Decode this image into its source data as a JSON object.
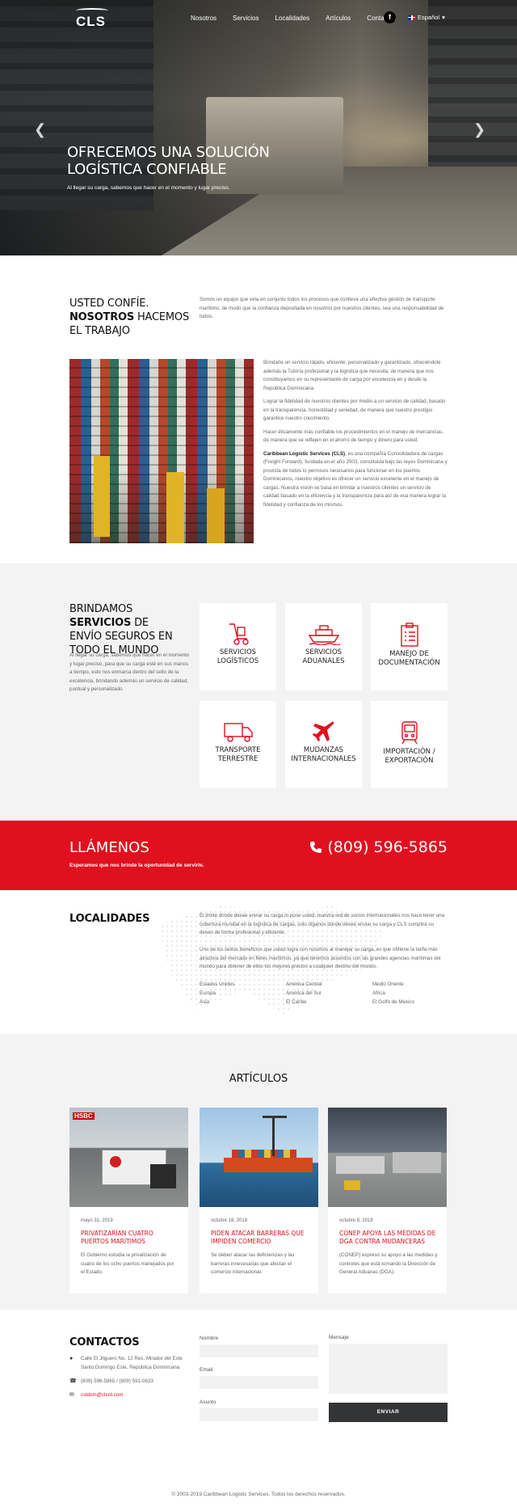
{
  "nav": {
    "logo": "CLS",
    "items": [
      "Nosotros",
      "Servicios",
      "Localidades",
      "Artículos",
      "Contactos"
    ],
    "facebook": "f",
    "language": "Español"
  },
  "hero": {
    "title": "OFRECEMOS UNA SOLUCIÓN LOGÍSTICA CONFIABLE",
    "subtitle": "Al llegar su carga, sabemos que hacer en el momento y lugar preciso.",
    "prev_icon": "chevron-left-icon",
    "next_icon": "chevron-right-icon"
  },
  "intro": {
    "heading_1": "USTED CONFÍE.",
    "heading_2_bold": "NOSOTROS",
    "heading_2_rest": " HACEMOS EL TRABAJO",
    "lead": "Somos un equipo que vela en conjunto todos los procesos que conlleva una efectiva gestión de transporte marítimo, de modo que la confianza depositada en nosotros por nuestros clientes, sea una responsabilidad de todos.",
    "p1": "Brindarle un servicio rápido, eficiente, personalizado y garantizado, ofreciéndole además la Tutoría profesional y la logística que necesita, de manera que nos constituyamos en su representante de carga por excelencia en y desde la República Dominicana.",
    "p2": "Lograr la fidelidad de nuestros clientes por medio a un servicio de calidad, basado en la transparencia, honestidad y seriedad, de manera que nuestro prestigio garantice nuestro crecimiento.",
    "p3": "Hacer éticamente más confiable los procedimientos en el manejo de mercancías, de manera que se reflejen en el ahorro de tiempo y dinero para usted.",
    "p4_bold": "Caribbean Logistic Services (CLS)",
    "p4_rest": ", es una compañía Consolidadora de cargas (Freight Forward), fundada en el año 2003, constituida bajo las leyes Dominicana y provista de todos lo permisos necesarios para funcionar en los puertos Dominicanos, nuestro objetivo es ofrecer un servicio excelente en el manejo de cargas. Nuestra visión se basa en brindar a nuestros clientes un servicio de calidad basado en la eficiencia y la transparencia para así de esa manera lograr la fidelidad y confianza de los mismos."
  },
  "services": {
    "h_a": "BRINDAMOS ",
    "h_b": "SERVICIOS",
    "h_c": " DE ENVÍO SEGUROS EN TODO EL MUNDO",
    "text": "Al llegar su carga, sabemos que hacer en el momento y lugar preciso, para que su carga esté en sus manos a tiempo, esto nos enmarca dentro del sello de la excelencia, brindando además un servicio de calidad, puntual y personalizado.",
    "cards": [
      {
        "label": "SERVICIOS LOGÍSTICOS",
        "icon": "hand-truck-icon"
      },
      {
        "label": "SERVICIOS ADUANALES",
        "icon": "ship-icon"
      },
      {
        "label": "MANEJO DE DOCUMENTACIÓN",
        "icon": "clipboard-icon"
      },
      {
        "label": "TRANSPORTE TERRESTRE",
        "icon": "truck-icon"
      },
      {
        "label": "MUDANZAS INTERNACIONALES",
        "icon": "airplane-icon"
      },
      {
        "label": "IMPORTACIÓN / EXPORTACIÓN",
        "icon": "train-icon"
      }
    ]
  },
  "call": {
    "title": "LLÁMENOS",
    "subtitle": "Esperamos que nos brinde la oportunidad de servirle.",
    "phone": "(809) 596-5865",
    "accent": "#e0101f"
  },
  "locations": {
    "title": "LOCALIDADES",
    "p1": "El límite donde desee enviar su carga lo pone usted, nuestra red de socios internacionales nos hace tener una cobertura mundial en la logística de cargas, solo díganos donde desee enviar su carga y CLS cumplirá su deseo de forma profesional y eficiente.",
    "p2": "Uno de los tantos beneficios que usted logra con nosotros al manejar su carga, es que obtiene la tarifa más atractiva del mercado en fletes marítimos, ya que tenemos acuerdos con las grandes agencias marítimas del mundo para obtener de ellos los mejores precios a cualquier destino del mundo.",
    "regions": [
      "Estados Unidos",
      "América Central",
      "Medio Oriente",
      "Europa",
      "América del Sur",
      "Africa",
      "Asia",
      "El Caribe",
      "El Golfo de México"
    ]
  },
  "articles": {
    "title": "ARTÍCULOS",
    "items": [
      {
        "date": "mayo 31, 2019",
        "title": "PRIVATIZARÍAN CUATRO PUERTOS MARÍTIMOS",
        "text": "El Gobierno estudia la privatización de cuatro de los ocho puertos manejados por el Estado."
      },
      {
        "date": "octubre 18, 2018",
        "title": "PIDEN ATACAR BARRERAS QUE IMPIDEN COMERCIO",
        "text": "Se deben atacar las deficiencias y las barreras innecesarias que afectan el comercio internacional."
      },
      {
        "date": "octubre 8, 2018",
        "title": "CONEP APOYA LAS MEDIDAS DE DGA CONTRA MUDANCERAS",
        "text": "(CONEP) expresó su apoyo a las medidas y controles que está tomando la Dirección de General Aduanas (DGA)."
      }
    ]
  },
  "contact": {
    "title": "CONTACTOS",
    "address": "Calle El Jilguero No. 12 Res. Mirador del Este Santo Domingo Este, República Dominicana",
    "phones": "(809) 596-5865 / (809) 591-0633",
    "email": "csldom@clsrd.com",
    "form": {
      "name": "Nombre",
      "email": "Email",
      "subject": "Asunto",
      "message": "Mensaje",
      "send": "ENVIAR"
    }
  },
  "footer": "© 2003-2019 Caribbean Logistic Services. Todos los derechos reservados."
}
